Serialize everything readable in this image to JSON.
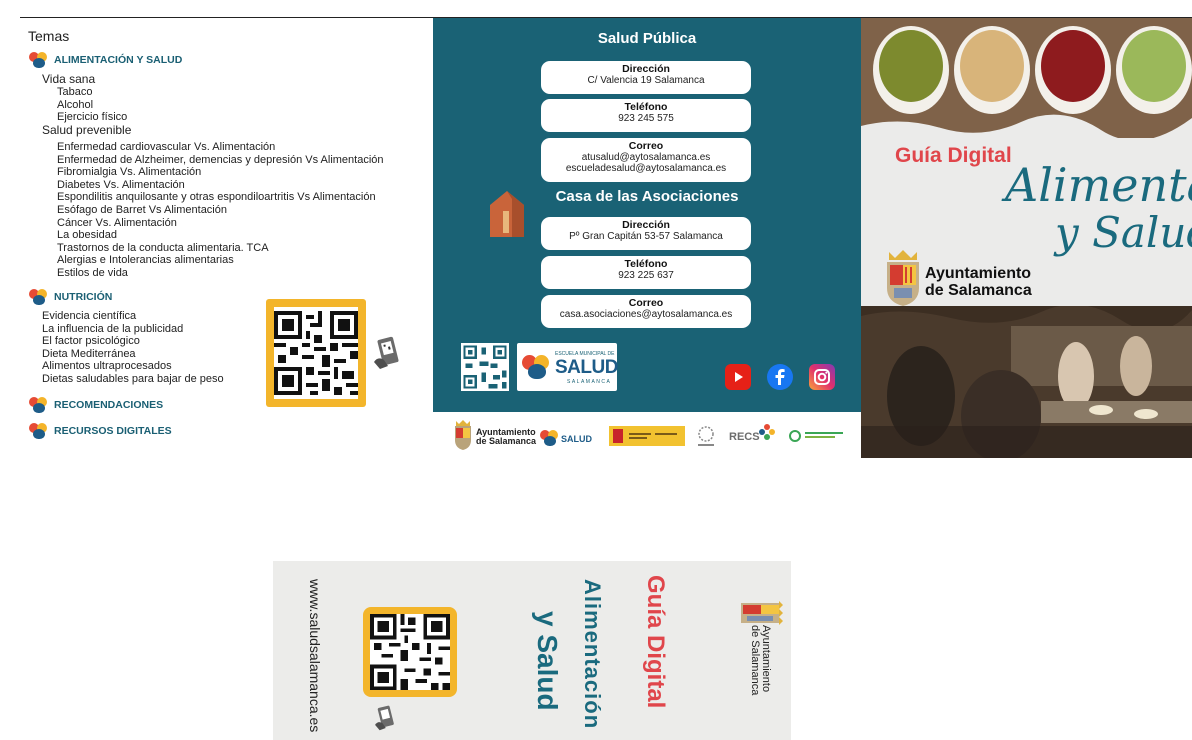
{
  "left": {
    "temas": "Temas",
    "sections": {
      "alimentacion": "ALIMENTACIÓN Y SALUD",
      "nutricion": "NUTRICIÓN",
      "recomendaciones": "RECOMENDACIONES",
      "recursos": "RECURSOS DIGITALES"
    },
    "vida_sana": "Vida sana",
    "vida_sana_items": [
      "Tabaco",
      "Alcohol",
      "Ejercicio físico"
    ],
    "salud_prevenible": "Salud prevenible",
    "salud_items": [
      "Enfermedad cardiovascular Vs. Alimentación",
      "Enfermedad de Alzheimer, demencias y depresión Vs Alimentación",
      "Fibromialgia Vs. Alimentación",
      "Diabetes Vs. Alimentación",
      "Espondilitis anquilosante y otras espondiloartritis Vs Alimentación",
      "Esófago de Barret Vs Alimentación",
      "Cáncer Vs. Alimentación",
      "La obesidad",
      "Trastornos de la conducta alimentaria. TCA",
      "Alergias e Intolerancias alimentarias",
      "Estilos de vida"
    ],
    "nutricion_items": [
      "Evidencia científica",
      "La influencia de la publicidad",
      "El factor psicológico",
      "Dieta Mediterránea",
      "Alimentos ultraprocesados",
      "Dietas saludables para bajar de peso"
    ]
  },
  "mid": {
    "title1": "Salud Pública",
    "sp_dir_label": "Dirección",
    "sp_dir": "C/ Valencia 19 Salamanca",
    "sp_tel_label": "Teléfono",
    "sp_tel": "923 245 575",
    "sp_mail_label": "Correo",
    "sp_mail1": "atusalud@aytosalamanca.es",
    "sp_mail2": "escueladesalud@aytosalamanca.es",
    "title2": "Casa de las Asociaciones",
    "ca_dir_label": "Dirección",
    "ca_dir": "Pº Gran Capitán 53-57 Salamanca",
    "ca_tel_label": "Teléfono",
    "ca_tel": "923 225 637",
    "ca_mail_label": "Correo",
    "ca_mail": "casa.asociaciones@aytosalamanca.es",
    "badge_small": "ESCUELA MUNICIPAL DE",
    "badge_big": "SALUD",
    "badge_city": "SALAMANCA"
  },
  "footer": {
    "ayto_line1": "Ayuntamiento",
    "ayto_line2": "de Salamanca",
    "salud": "SALUD",
    "recs": "RECS"
  },
  "cover": {
    "guia": "Guía Digital",
    "script1": "Alimentac",
    "script2": "y Salud",
    "ayto_line1": "Ayuntamiento",
    "ayto_line2": "de Salamanca"
  },
  "back": {
    "web": "www.saludsalamanca.es",
    "guia": "Guía Digital",
    "alim": "Alimentación",
    "ys": "y Salud",
    "ayto_line1": "Ayuntamiento",
    "ayto_line2": "de Salamanca"
  },
  "colors": {
    "teal": "#1a6275",
    "qr_frame": "#f3b52b",
    "accent_red": "#e0464b"
  }
}
